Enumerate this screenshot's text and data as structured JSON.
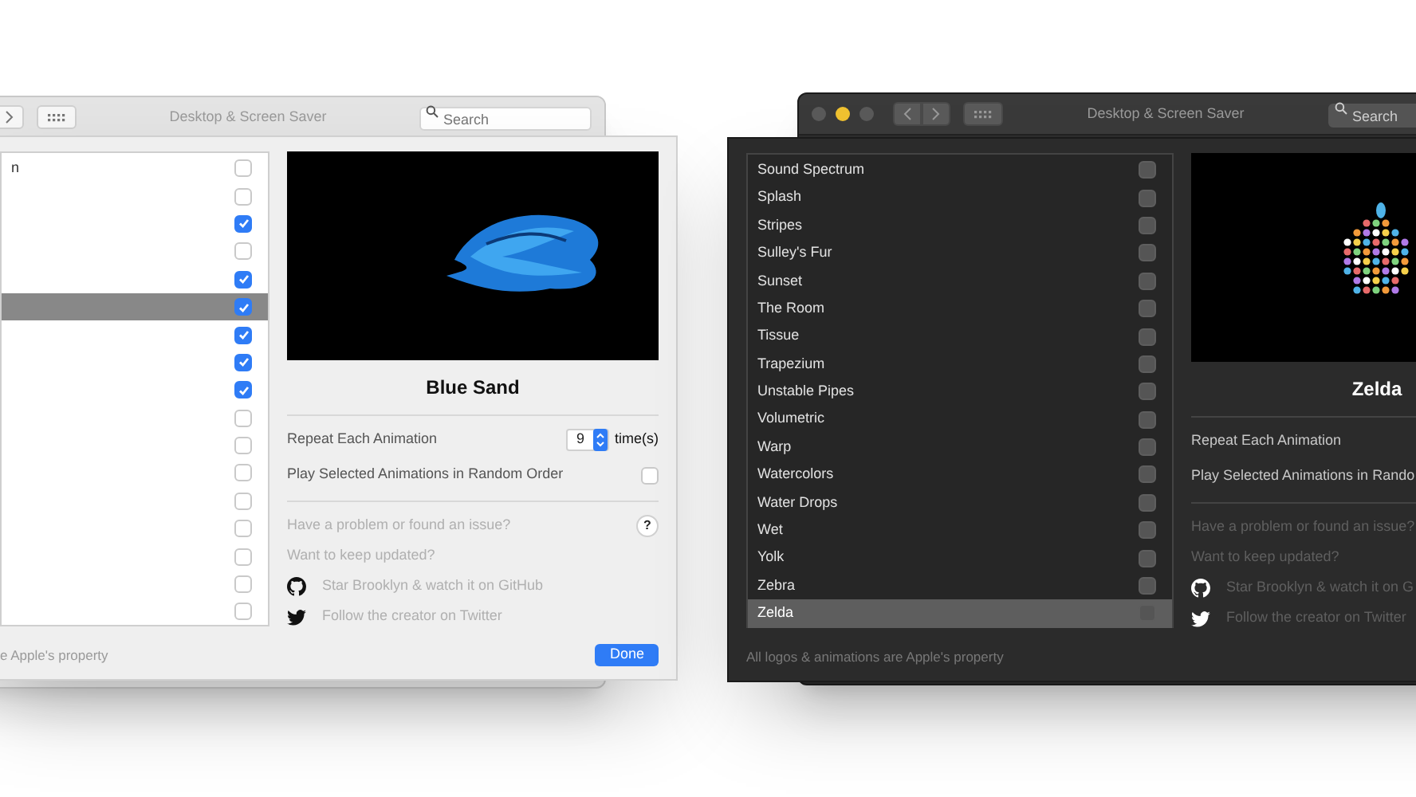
{
  "windows": [
    {
      "kind": "light",
      "title": "Desktop & Screen Saver",
      "traffic_lights": false,
      "search_placeholder": "Search",
      "animations": [
        {
          "label": "n",
          "checked": false,
          "selected": false
        },
        {
          "checked": false,
          "selected": false
        },
        {
          "checked": true,
          "selected": false
        },
        {
          "checked": false,
          "selected": false
        },
        {
          "checked": true,
          "selected": false
        },
        {
          "checked": true,
          "selected": true
        },
        {
          "checked": true,
          "selected": false
        },
        {
          "checked": true,
          "selected": false
        },
        {
          "checked": true,
          "selected": false
        },
        {
          "checked": false,
          "selected": false
        },
        {
          "checked": false,
          "selected": false
        },
        {
          "checked": false,
          "selected": false
        },
        {
          "checked": false,
          "selected": false
        },
        {
          "checked": false,
          "selected": false
        },
        {
          "checked": false,
          "selected": false
        },
        {
          "checked": false,
          "selected": false
        },
        {
          "checked": false,
          "selected": false
        }
      ],
      "preview": {
        "kind": "sand",
        "title": "Blue Sand"
      },
      "repeat": {
        "label": "Repeat Each Animation",
        "value": "9",
        "unit": "time(s)"
      },
      "random": {
        "label": "Play Selected Animations in Random Order",
        "checked": false
      },
      "issue": "Have a problem or found an issue?",
      "help": "?",
      "updated": "Want to keep updated?",
      "github": "Star Brooklyn & watch it on GitHub",
      "twitter": "Follow the creator on Twitter",
      "footer": "e Apple's property",
      "done": "Done"
    },
    {
      "kind": "dark",
      "title": "Desktop & Screen Saver",
      "traffic_lights": true,
      "search_placeholder": "Search",
      "animations": [
        {
          "label": "Sound Spectrum",
          "checked": false,
          "selected": false
        },
        {
          "label": "Splash",
          "checked": false,
          "selected": false
        },
        {
          "label": "Stripes",
          "checked": false,
          "selected": false
        },
        {
          "label": "Sulley's Fur",
          "checked": false,
          "selected": false
        },
        {
          "label": "Sunset",
          "checked": false,
          "selected": false
        },
        {
          "label": "The Room",
          "checked": false,
          "selected": false
        },
        {
          "label": "Tissue",
          "checked": false,
          "selected": false
        },
        {
          "label": "Trapezium",
          "checked": false,
          "selected": false
        },
        {
          "label": "Unstable Pipes",
          "checked": false,
          "selected": false
        },
        {
          "label": "Volumetric",
          "checked": false,
          "selected": false
        },
        {
          "label": "Warp",
          "checked": false,
          "selected": false
        },
        {
          "label": "Watercolors",
          "checked": false,
          "selected": false
        },
        {
          "label": "Water Drops",
          "checked": false,
          "selected": false
        },
        {
          "label": "Wet",
          "checked": false,
          "selected": false
        },
        {
          "label": "Yolk",
          "checked": false,
          "selected": false
        },
        {
          "label": "Zebra",
          "checked": false,
          "selected": false
        },
        {
          "label": "Zelda",
          "checked": false,
          "selected": true
        }
      ],
      "preview": {
        "kind": "dots",
        "title": "Zelda"
      },
      "repeat": {
        "label": "Repeat Each Animation"
      },
      "random": {
        "label": "Play Selected Animations in Rando"
      },
      "issue": "Have a problem or found an issue?",
      "updated": "Want to keep updated?",
      "github": "Star Brooklyn & watch it on G",
      "twitter": "Follow the creator on Twitter",
      "footer": "All logos & animations are Apple's property"
    }
  ]
}
